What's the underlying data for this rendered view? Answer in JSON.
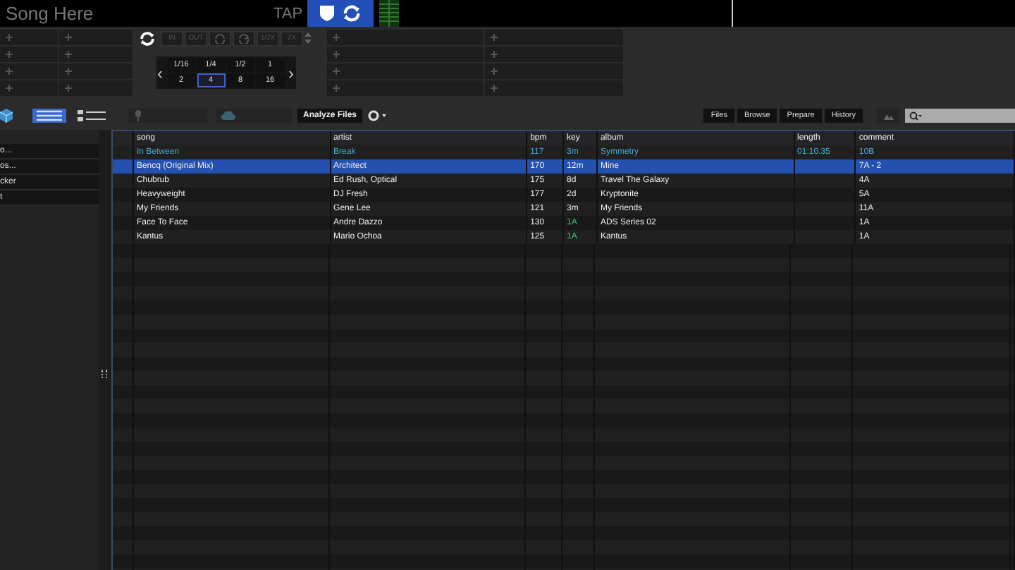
{
  "deck": {
    "song_title": "Song Here",
    "tap": "TAP"
  },
  "loop_buttons": [
    {
      "kind": "text",
      "label": "IN"
    },
    {
      "kind": "text",
      "label": "OUT"
    },
    {
      "kind": "loop_in"
    },
    {
      "kind": "loop_out"
    },
    {
      "kind": "text",
      "label": "1/2X"
    },
    {
      "kind": "text",
      "label": "2X"
    }
  ],
  "beat_nav": {
    "previous": "‹",
    "next": "›"
  },
  "beat_jumps": [
    {
      "label": "1/16",
      "selected": false
    },
    {
      "label": "1/4",
      "selected": false
    },
    {
      "label": "1/2",
      "selected": false
    },
    {
      "label": "1",
      "selected": false
    },
    {
      "label": "2",
      "selected": false
    },
    {
      "label": "4",
      "selected": true
    },
    {
      "label": "8",
      "selected": false
    },
    {
      "label": "16",
      "selected": false
    }
  ],
  "toolbar": {
    "analyze": "Analyze Files",
    "tabs": [
      {
        "label": "Files",
        "selected": false
      },
      {
        "label": "Browse",
        "selected": false
      },
      {
        "label": "Prepare",
        "selected": false
      },
      {
        "label": "History",
        "selected": false
      }
    ]
  },
  "sidebar": {
    "items": [
      "o...",
      "os...",
      "cker",
      "t"
    ]
  },
  "table": {
    "columns": [
      "song",
      "artist",
      "bpm",
      "key",
      "album",
      "length",
      "comment"
    ],
    "rows": [
      {
        "song": "In Between",
        "artist": "Break",
        "bpm": "117",
        "key": "3m",
        "key_match": false,
        "album": "Symmetry",
        "length": "01:10.35",
        "comment": "10B",
        "loaded": true,
        "selected": false
      },
      {
        "song": "Bencq (Original Mix)",
        "artist": "Architect",
        "bpm": "170",
        "key": "12m",
        "key_match": false,
        "album": "Mine",
        "length": "",
        "comment": "7A - 2",
        "loaded": false,
        "selected": true
      },
      {
        "song": "Chubrub",
        "artist": "Ed Rush, Optical",
        "bpm": "175",
        "key": "8d",
        "key_match": false,
        "album": "Travel The Galaxy",
        "length": "",
        "comment": "4A",
        "loaded": false,
        "selected": false
      },
      {
        "song": "Heavyweight",
        "artist": "DJ Fresh",
        "bpm": "177",
        "key": "2d",
        "key_match": false,
        "album": "Kryptonite",
        "length": "",
        "comment": "5A",
        "loaded": false,
        "selected": false
      },
      {
        "song": "My Friends",
        "artist": "Gene Lee",
        "bpm": "121",
        "key": "3m",
        "key_match": false,
        "album": "My Friends",
        "length": "",
        "comment": "11A",
        "loaded": false,
        "selected": false
      },
      {
        "song": "Face To Face",
        "artist": "Andre Dazzo",
        "bpm": "130",
        "key": "1A",
        "key_match": true,
        "album": "ADS Series 02",
        "length": "",
        "comment": "1A",
        "loaded": false,
        "selected": false
      },
      {
        "song": "Kantus",
        "artist": "Mario Ochoa",
        "bpm": "125",
        "key": "1A",
        "key_match": true,
        "album": "Kantus",
        "length": "",
        "comment": "1A",
        "loaded": false,
        "selected": false
      }
    ]
  }
}
